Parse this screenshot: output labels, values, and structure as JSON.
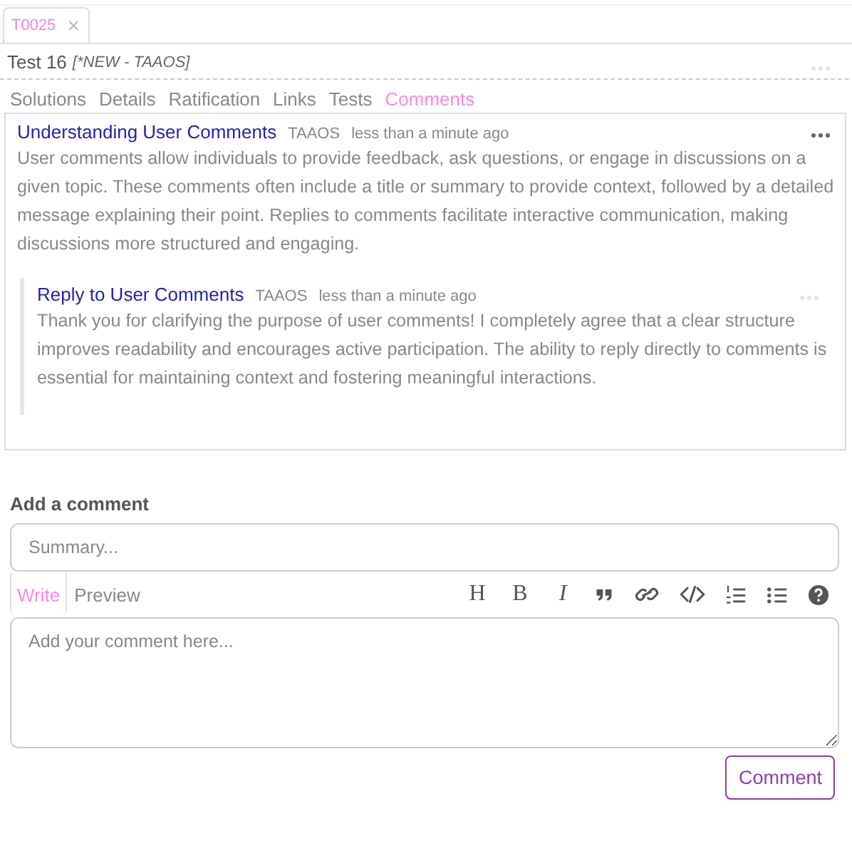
{
  "doc_tabs": [
    {
      "label": "T0025",
      "close": "×",
      "selected": true
    }
  ],
  "title": {
    "name": "Test 16",
    "status": "[*NEW - TAAOS]"
  },
  "nav_tabs": [
    {
      "label": "Solutions",
      "selected": false
    },
    {
      "label": "Details",
      "selected": false
    },
    {
      "label": "Ratification",
      "selected": false
    },
    {
      "label": "Links",
      "selected": false
    },
    {
      "label": "Tests",
      "selected": false
    },
    {
      "label": "Comments",
      "selected": true
    }
  ],
  "comments": [
    {
      "title": "Understanding User Comments",
      "author": "TAAOS",
      "time": "less than a minute ago",
      "body": "User comments allow individuals to provide feedback, ask questions, or engage in discussions on a given topic. These comments often include a title or summary to provide context, followed by a detailed message explaining their point. Replies to comments facilitate interactive communication, making discussions more structured and engaging.",
      "replies": [
        {
          "title": "Reply to User Comments",
          "author": "TAAOS",
          "time": "less than a minute ago",
          "body": "Thank you for clarifying the purpose of user comments! I completely agree that a clear structure improves readability and encourages active participation. The ability to reply directly to comments is essential for maintaining context and fostering meaningful interactions."
        }
      ]
    }
  ],
  "add_comment": {
    "heading": "Add a comment",
    "summary_placeholder": "Summary...",
    "editor_tabs": [
      {
        "label": "Write",
        "selected": true
      },
      {
        "label": "Preview",
        "selected": false
      }
    ],
    "toolbar": [
      {
        "kind": "heading",
        "label": "H"
      },
      {
        "kind": "bold",
        "label": "B"
      },
      {
        "kind": "italic",
        "label": "I"
      },
      {
        "kind": "quote"
      },
      {
        "kind": "link"
      },
      {
        "kind": "code"
      },
      {
        "kind": "ordered-list"
      },
      {
        "kind": "unordered-list"
      },
      {
        "kind": "help"
      }
    ],
    "body_placeholder": "Add your comment here...",
    "submit": "Comment"
  }
}
